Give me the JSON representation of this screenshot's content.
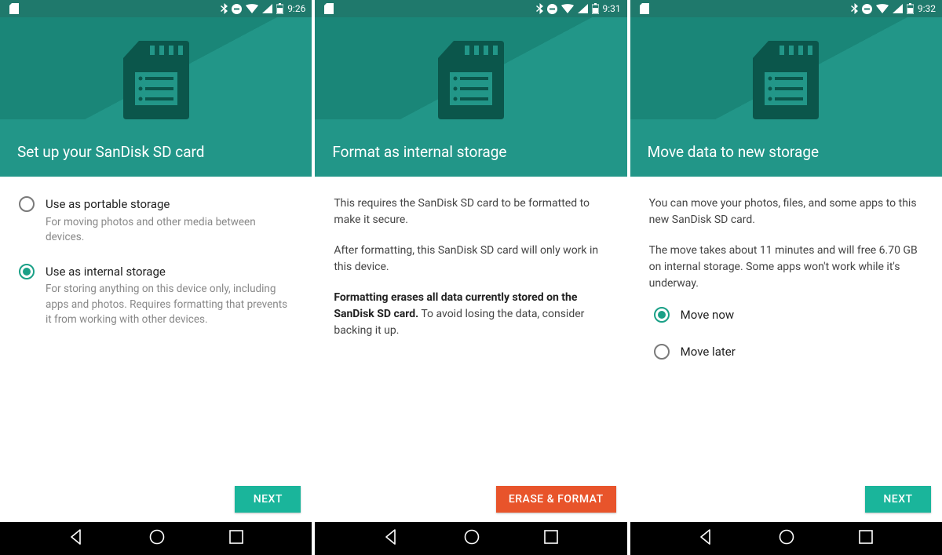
{
  "screens": [
    {
      "time": "9:26",
      "title": "Set up your SanDisk SD card",
      "options": [
        {
          "title": "Use as portable storage",
          "desc": "For moving photos and other media between devices.",
          "checked": false
        },
        {
          "title": "Use as internal storage",
          "desc": "For storing anything on this device only, including apps and photos. Requires formatting that prevents it from working with other devices.",
          "checked": true
        }
      ],
      "button": {
        "label": "NEXT",
        "variant": "teal"
      }
    },
    {
      "time": "9:31",
      "title": "Format as internal storage",
      "paragraphs": [
        {
          "plain": "This requires the SanDisk SD card to be formatted to make it secure."
        },
        {
          "plain": "After formatting, this SanDisk SD card will only work in this device."
        },
        {
          "bold": "Formatting erases all data currently stored on the SanDisk SD card.",
          "plain": " To avoid losing the data, consider backing it up."
        }
      ],
      "button": {
        "label": "ERASE & FORMAT",
        "variant": "red"
      }
    },
    {
      "time": "9:32",
      "title": "Move data to new storage",
      "paragraphs": [
        {
          "plain": "You can move your photos, files, and some apps to this new SanDisk SD card."
        },
        {
          "plain": "The move takes about 11 minutes and will free 6.70 GB on internal storage. Some apps won't work while it's underway."
        }
      ],
      "options": [
        {
          "title": "Move now",
          "desc": "",
          "checked": true
        },
        {
          "title": "Move later",
          "desc": "",
          "checked": false
        }
      ],
      "button": {
        "label": "NEXT",
        "variant": "teal"
      }
    }
  ]
}
